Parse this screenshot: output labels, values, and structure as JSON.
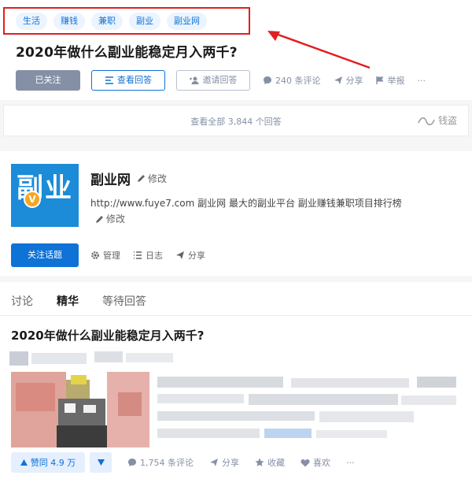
{
  "question": {
    "tags": [
      "生活",
      "赚钱",
      "兼职",
      "副业",
      "副业网"
    ],
    "title": "2020年做什么副业能稳定月入两千?",
    "followed_label": "已关注",
    "view_answers_label": "查看回答",
    "invite_label": "邀请回答",
    "comments_label": "240 条评论",
    "share_label": "分享",
    "report_label": "举报",
    "more_label": "···"
  },
  "all_answers": {
    "label": "查看全部 3,844 个回答",
    "watermark": "钱盗"
  },
  "topic": {
    "logo_text": "副业",
    "badge": "V",
    "name": "副业网",
    "edit_label": "修改",
    "description": "http://www.fuye7.com 副业网 最大的副业平台 副业赚钱兼职项目排行榜",
    "desc_edit_label": "修改",
    "follow_label": "关注话题",
    "manage_label": "管理",
    "log_label": "日志",
    "share_label": "分享"
  },
  "tabs": [
    "讨论",
    "精华",
    "等待回答"
  ],
  "answer": {
    "title": "2020年做什么副业能稳定月入两千?",
    "vote_label": "赞同 4.9 万",
    "comments_label": "1,754 条评论",
    "share_label": "分享",
    "collect_label": "收藏",
    "like_label": "喜欢",
    "more_label": "···"
  },
  "colors": {
    "accent": "#0f72d6",
    "highlight": "#e02020",
    "muted": "#8590a6"
  }
}
